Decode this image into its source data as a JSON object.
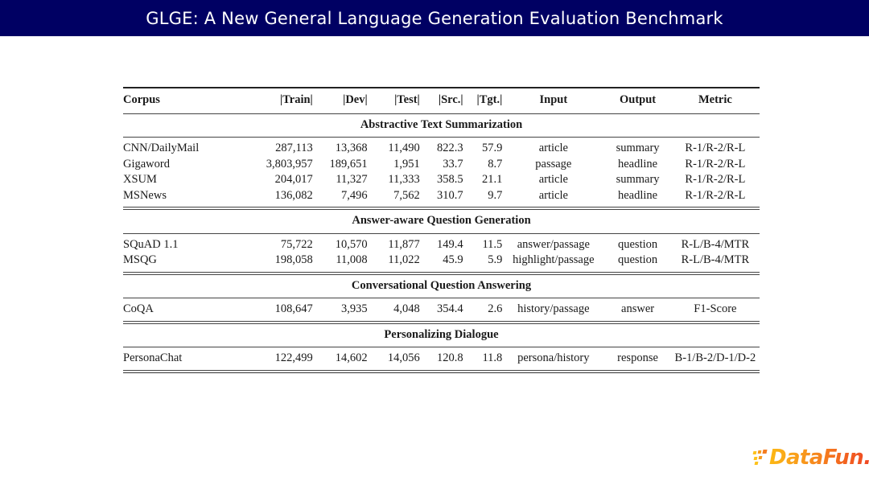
{
  "slide": {
    "title": "GLGE: A New General Language Generation Evaluation Benchmark",
    "banner_color": "#000063",
    "background_color": "#ffffff"
  },
  "table": {
    "columns": [
      {
        "key": "corpus",
        "label": "Corpus"
      },
      {
        "key": "train",
        "label": "|Train|"
      },
      {
        "key": "dev",
        "label": "|Dev|"
      },
      {
        "key": "test",
        "label": "|Test|"
      },
      {
        "key": "src",
        "label": "|Src.|"
      },
      {
        "key": "tgt",
        "label": "|Tgt.|"
      },
      {
        "key": "input",
        "label": "Input"
      },
      {
        "key": "output",
        "label": "Output"
      },
      {
        "key": "metric",
        "label": "Metric"
      }
    ],
    "sections": [
      {
        "title": "Abstractive Text Summarization",
        "rows": [
          {
            "corpus": "CNN/DailyMail",
            "train": "287,113",
            "dev": "13,368",
            "test": "11,490",
            "src": "822.3",
            "tgt": "57.9",
            "input": "article",
            "output": "summary",
            "metric": "R-1/R-2/R-L"
          },
          {
            "corpus": "Gigaword",
            "train": "3,803,957",
            "dev": "189,651",
            "test": "1,951",
            "src": "33.7",
            "tgt": "8.7",
            "input": "passage",
            "output": "headline",
            "metric": "R-1/R-2/R-L"
          },
          {
            "corpus": "XSUM",
            "train": "204,017",
            "dev": "11,327",
            "test": "11,333",
            "src": "358.5",
            "tgt": "21.1",
            "input": "article",
            "output": "summary",
            "metric": "R-1/R-2/R-L"
          },
          {
            "corpus": "MSNews",
            "train": "136,082",
            "dev": "7,496",
            "test": "7,562",
            "src": "310.7",
            "tgt": "9.7",
            "input": "article",
            "output": "headline",
            "metric": "R-1/R-2/R-L"
          }
        ]
      },
      {
        "title": "Answer-aware Question Generation",
        "rows": [
          {
            "corpus": "SQuAD 1.1",
            "train": "75,722",
            "dev": "10,570",
            "test": "11,877",
            "src": "149.4",
            "tgt": "11.5",
            "input": "answer/passage",
            "output": "question",
            "metric": "R-L/B-4/MTR"
          },
          {
            "corpus": "MSQG",
            "train": "198,058",
            "dev": "11,008",
            "test": "11,022",
            "src": "45.9",
            "tgt": "5.9",
            "input": "highlight/passage",
            "output": "question",
            "metric": "R-L/B-4/MTR"
          }
        ]
      },
      {
        "title": "Conversational Question Answering",
        "rows": [
          {
            "corpus": "CoQA",
            "train": "108,647",
            "dev": "3,935",
            "test": "4,048",
            "src": "354.4",
            "tgt": "2.6",
            "input": "history/passage",
            "output": "answer",
            "metric": "F1-Score"
          }
        ]
      },
      {
        "title": "Personalizing Dialogue",
        "rows": [
          {
            "corpus": "PersonaChat",
            "train": "122,499",
            "dev": "14,602",
            "test": "14,056",
            "src": "120.8",
            "tgt": "11.8",
            "input": "persona/history",
            "output": "response",
            "metric": "B-1/B-2/D-1/D-2"
          }
        ]
      }
    ]
  },
  "logo": {
    "text": "DataFun.",
    "dots_icon": "datafun-dots-icon",
    "colors": [
      "#fcb814",
      "#f89a1c",
      "#f4701f",
      "#ef4623"
    ]
  }
}
